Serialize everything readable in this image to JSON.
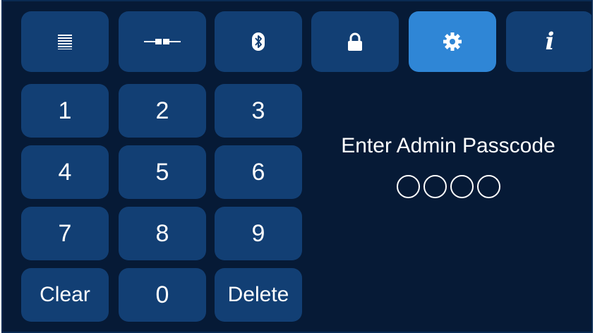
{
  "toolbar": {
    "tabs": [
      {
        "icon": "list-lines-icon",
        "active": false
      },
      {
        "icon": "connector-icon",
        "active": false
      },
      {
        "icon": "bluetooth-icon",
        "active": false
      },
      {
        "icon": "lock-icon",
        "active": false
      },
      {
        "icon": "gear-icon",
        "active": true
      },
      {
        "icon": "info-icon",
        "label": "i",
        "active": false
      }
    ]
  },
  "keypad": {
    "k1": "1",
    "k2": "2",
    "k3": "3",
    "k4": "4",
    "k5": "5",
    "k6": "6",
    "k7": "7",
    "k8": "8",
    "k9": "9",
    "clear": "Clear",
    "k0": "0",
    "delete": "Delete"
  },
  "passcode": {
    "prompt": "Enter Admin Passcode",
    "digits_entered": 0,
    "digits_total": 4
  },
  "colors": {
    "background": "#061a36",
    "button": "#123f74",
    "active": "#2f86d6",
    "text": "#ffffff"
  }
}
